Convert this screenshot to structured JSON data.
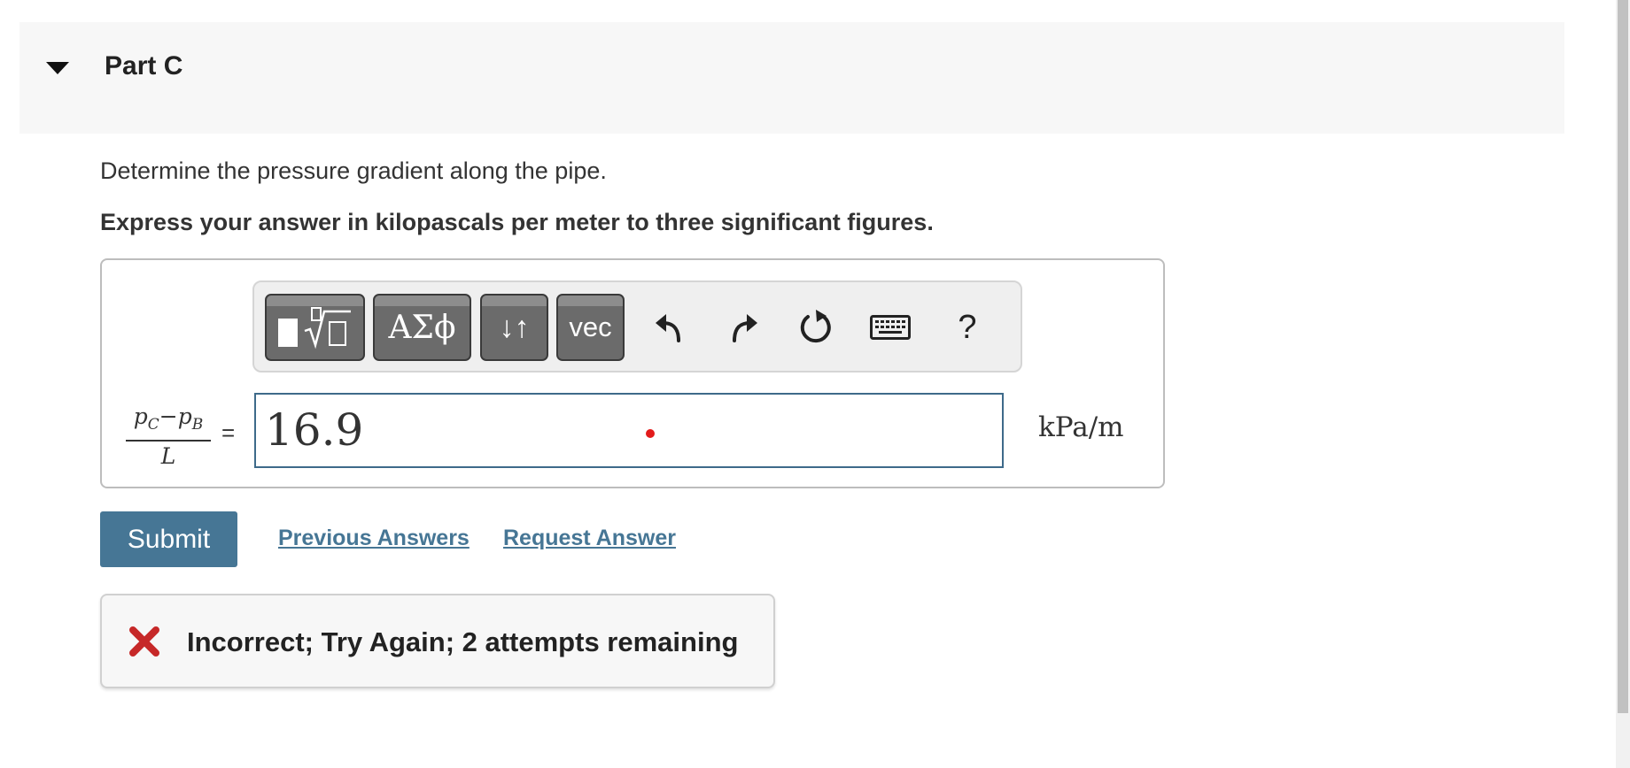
{
  "part": {
    "title": "Part C"
  },
  "question": {
    "prompt": "Determine the pressure gradient along the pipe.",
    "instruction": "Express your answer in kilopascals per meter to three significant figures."
  },
  "toolbar": {
    "buttons": [
      {
        "name": "templates",
        "icon": "templates-icon"
      },
      {
        "name": "greek",
        "label": "ΑΣϕ"
      },
      {
        "name": "arrows",
        "label": "↓↑"
      },
      {
        "name": "vec",
        "label": "vec"
      }
    ],
    "icons": [
      "undo-icon",
      "redo-icon",
      "reset-icon",
      "keyboard-icon"
    ],
    "help_label": "?"
  },
  "equation": {
    "numerator_a": "p",
    "numerator_a_sub": "C",
    "minus": "−",
    "numerator_b": "p",
    "numerator_b_sub": "B",
    "denominator": "L",
    "equals": "=",
    "answer_value": "16.9",
    "units": "kPa/m"
  },
  "actions": {
    "submit_label": "Submit",
    "previous_answers_label": "Previous Answers",
    "request_answer_label": "Request Answer"
  },
  "feedback": {
    "message": "Incorrect; Try Again; 2 attempts remaining",
    "icon": "x-icon",
    "color": "#c62828"
  },
  "colors": {
    "accent": "#467695",
    "input_border": "#3e6a8a",
    "header_bg": "#f7f7f7"
  }
}
